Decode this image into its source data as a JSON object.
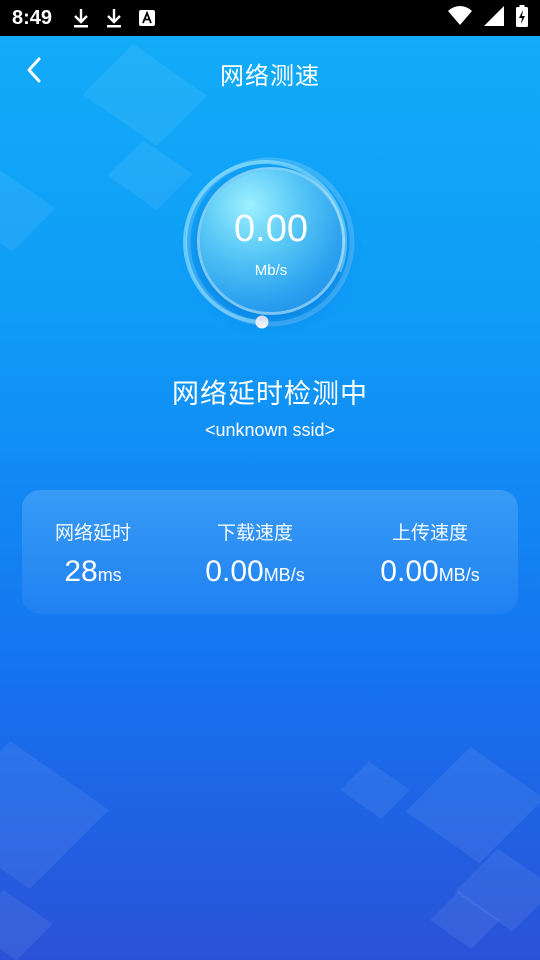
{
  "status_bar": {
    "time": "8:49",
    "left_icons": [
      "download-icon",
      "download-icon",
      "font-a-icon"
    ],
    "right_icons": [
      "wifi-icon",
      "signal-icon",
      "battery-charging-icon"
    ]
  },
  "header": {
    "title": "网络测速",
    "back_icon": "chevron-left-icon"
  },
  "gauge": {
    "value": "0.00",
    "unit": "Mb/s",
    "progress": 0
  },
  "status_text": "网络延时检测中",
  "ssid": "<unknown ssid>",
  "stats": {
    "latency": {
      "label": "网络延时",
      "value": "28",
      "unit": "ms"
    },
    "download": {
      "label": "下载速度",
      "value": "0.00",
      "unit": "MB/s"
    },
    "upload": {
      "label": "上传速度",
      "value": "0.00",
      "unit": "MB/s"
    }
  },
  "colors": {
    "bg_top": "#12aef8",
    "bg_bottom": "#2a52d8",
    "text": "#ffffff"
  }
}
